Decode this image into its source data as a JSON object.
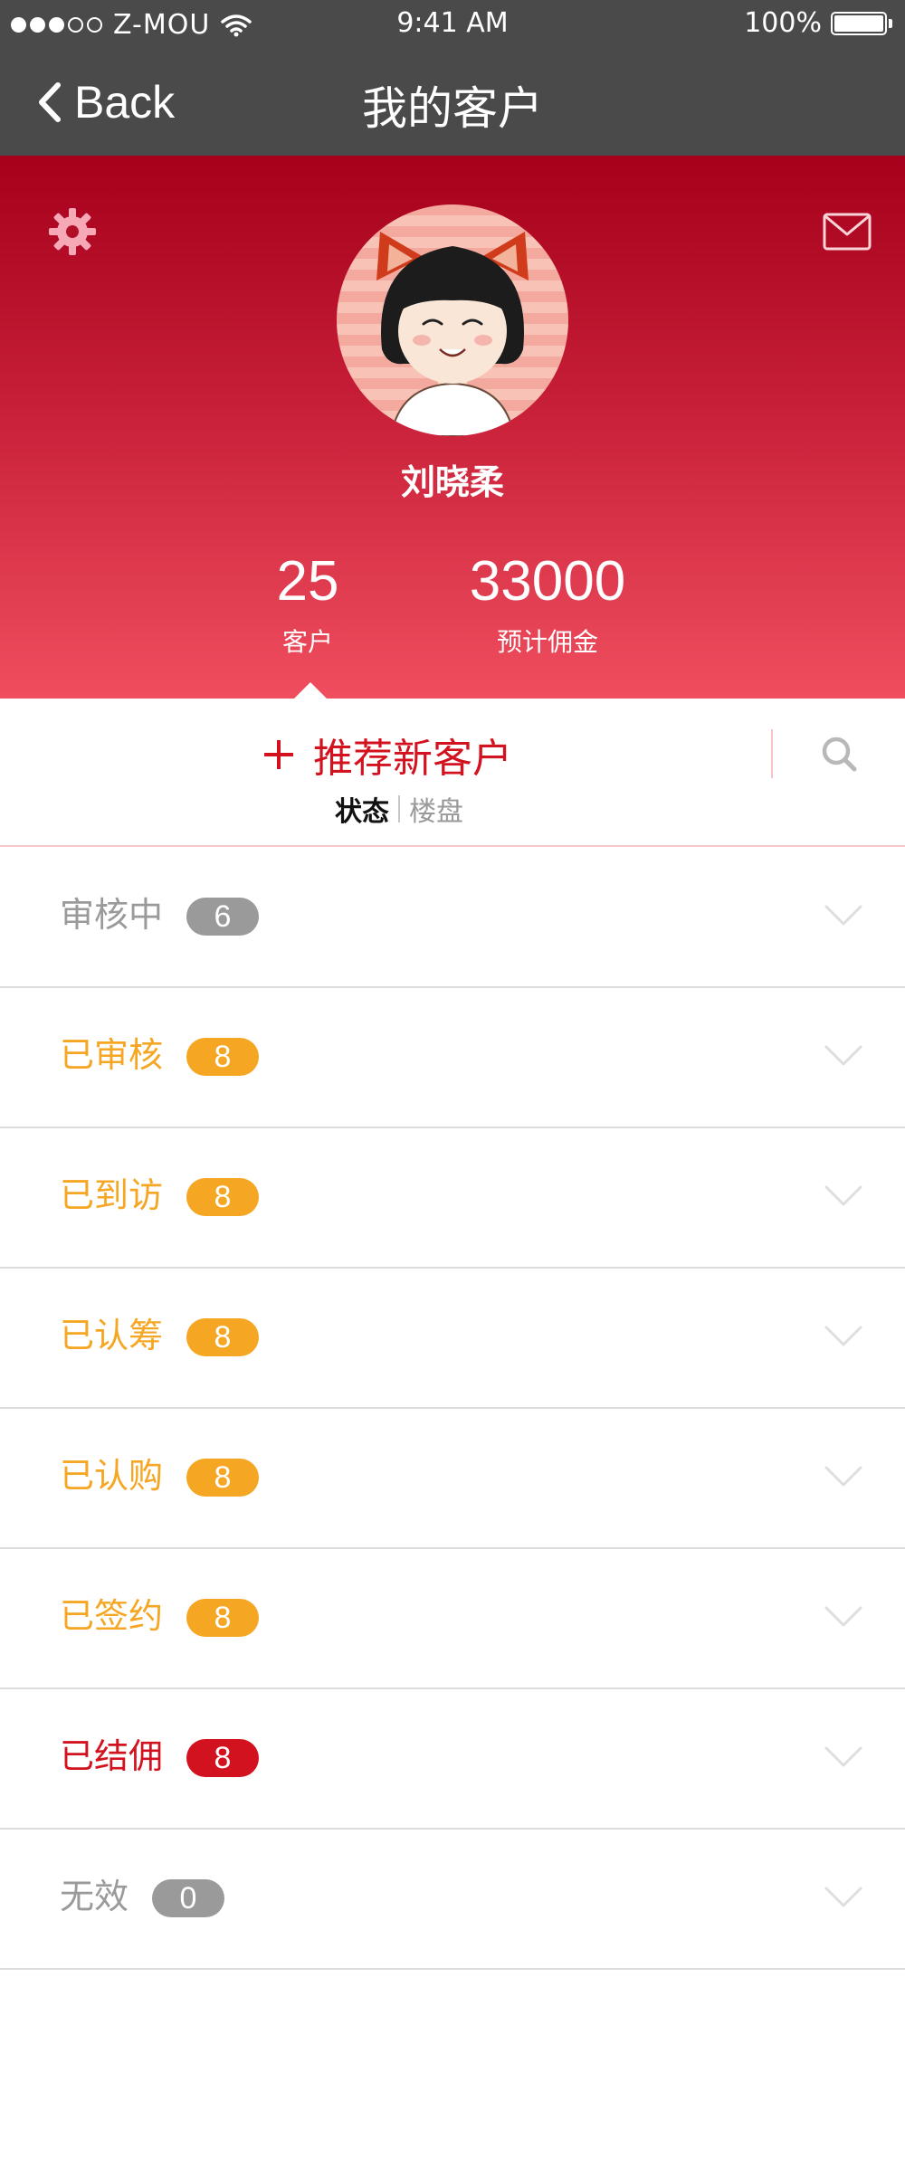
{
  "status_bar": {
    "carrier": "Z-MOU",
    "time": "9:41 AM",
    "battery": "100%",
    "signal_bars_filled": 3,
    "signal_bars_total": 5
  },
  "nav": {
    "back_label": "Back",
    "title": "我的客户"
  },
  "profile": {
    "name": "刘晓柔",
    "customers_value": "25",
    "customers_label": "客户",
    "commission_value": "33000",
    "commission_label": "预计佣金",
    "settings_icon": "gear-icon",
    "mail_icon": "mail-icon"
  },
  "actions": {
    "recommend_label": "推荐新客户",
    "tab_status": "状态",
    "tab_property": "楼盘",
    "search_icon": "search-icon"
  },
  "colors": {
    "header_top": "#a6001c",
    "header_bottom": "#f04e5f",
    "nav_bg": "#4a4a4a",
    "accent_red": "#d3121f",
    "orange": "#f5a623",
    "gray": "#9a9a9a"
  },
  "status_list": [
    {
      "name": "审核中",
      "count": "6",
      "text_color": "#9a9a9a",
      "badge_color": "#9a9a9a"
    },
    {
      "name": "已审核",
      "count": "8",
      "text_color": "#f5a623",
      "badge_color": "#f5a623"
    },
    {
      "name": "已到访",
      "count": "8",
      "text_color": "#f5a623",
      "badge_color": "#f5a623"
    },
    {
      "name": "已认筹",
      "count": "8",
      "text_color": "#f5a623",
      "badge_color": "#f5a623"
    },
    {
      "name": "已认购",
      "count": "8",
      "text_color": "#f5a623",
      "badge_color": "#f5a623"
    },
    {
      "name": "已签约",
      "count": "8",
      "text_color": "#f5a623",
      "badge_color": "#f5a623"
    },
    {
      "name": "已结佣",
      "count": "8",
      "text_color": "#d3121f",
      "badge_color": "#d3121f"
    },
    {
      "name": "无效",
      "count": "0",
      "text_color": "#9a9a9a",
      "badge_color": "#9a9a9a"
    }
  ]
}
